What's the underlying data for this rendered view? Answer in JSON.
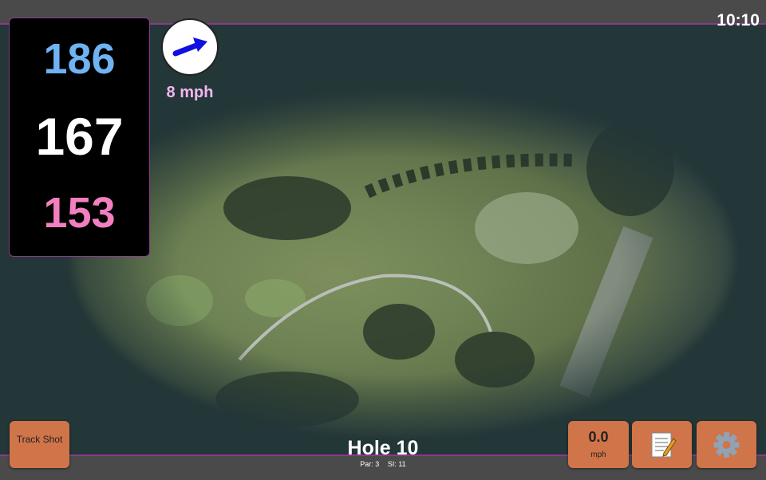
{
  "clock": "10:10",
  "distances": {
    "back": "186",
    "middle": "167",
    "front": "153"
  },
  "wind": {
    "speed": "8 mph",
    "icon": "wind-direction-arrow-icon"
  },
  "buttons": {
    "track_shot": "Track Shot",
    "notes_icon": "notepad-icon",
    "settings_icon": "gear-icon"
  },
  "speed": {
    "value": "0.0",
    "unit": "mph"
  },
  "hole": {
    "title": "Hole 10",
    "par": "Par: 3",
    "si": "SI: 11"
  },
  "colors": {
    "back": "#6fb3f2",
    "middle": "#ffffff",
    "front": "#f27fc0",
    "button": "#d0744a",
    "accent": "#8a3a8a"
  }
}
